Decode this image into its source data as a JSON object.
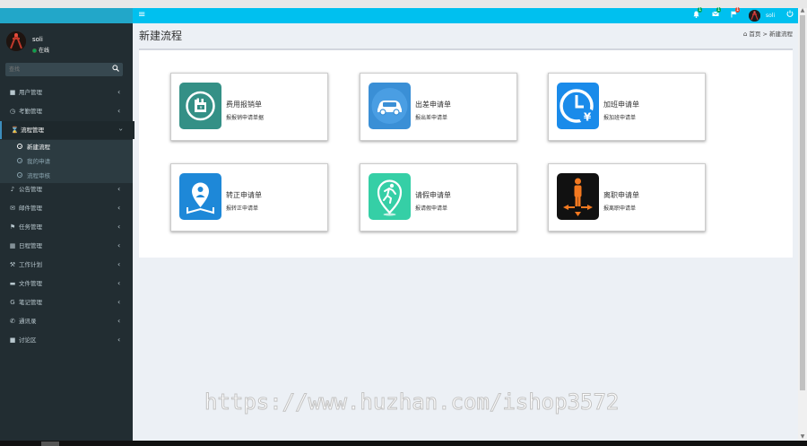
{
  "header": {
    "menu_icon": "hamburger-icon",
    "notifications": [
      {
        "icon": "bell-icon",
        "count": "1",
        "color": "#00a65a"
      },
      {
        "icon": "envelope-icon",
        "count": "1",
        "color": "#00a65a"
      },
      {
        "icon": "flag-icon",
        "count": "1",
        "color": "#dd4b39"
      }
    ],
    "username": "soli",
    "power_icon": "power-icon"
  },
  "sidebar": {
    "user": {
      "name": "soli",
      "status": "在线"
    },
    "search": {
      "placeholder": "查找"
    },
    "items": [
      {
        "label": "用户管理",
        "icon": "users-icon"
      },
      {
        "label": "考勤管理",
        "icon": "clock-icon"
      },
      {
        "label": "流程管理",
        "icon": "hourglass-icon",
        "open": true
      },
      {
        "label": "公告管理",
        "icon": "bell-icon"
      },
      {
        "label": "邮件管理",
        "icon": "envelope-icon"
      },
      {
        "label": "任务管理",
        "icon": "flag-icon"
      },
      {
        "label": "日程管理",
        "icon": "calendar-icon"
      },
      {
        "label": "工作计划",
        "icon": "wrench-icon"
      },
      {
        "label": "文件管理",
        "icon": "folder-icon"
      },
      {
        "label": "笔记管理",
        "icon": "note-icon"
      },
      {
        "label": "通讯录",
        "icon": "phone-icon"
      },
      {
        "label": "讨论区",
        "icon": "comment-icon"
      }
    ],
    "submenu": [
      {
        "label": "新建流程",
        "active": true
      },
      {
        "label": "我的申请",
        "active": false
      },
      {
        "label": "流程审核",
        "active": false
      }
    ]
  },
  "page": {
    "title": "新建流程",
    "breadcrumb": {
      "home": "首页",
      "separator": ">",
      "current": "新建流程"
    }
  },
  "cards": [
    {
      "title": "费用报销单",
      "subtitle": "报报销申请单据",
      "icon": "hand-pay-icon",
      "color": "#2e8b82"
    },
    {
      "title": "出差申请单",
      "subtitle": "报出差申请单",
      "icon": "car-icon",
      "color": "#3a8fd6"
    },
    {
      "title": "加班申请单",
      "subtitle": "报加班申请单",
      "icon": "clock-yen-icon",
      "color": "#2f86e0"
    },
    {
      "title": "转正申请单",
      "subtitle": "报转正申请单",
      "icon": "map-person-icon",
      "color": "#1e88d8"
    },
    {
      "title": "请假申请单",
      "subtitle": "报请假申请单",
      "icon": "runner-icon",
      "color": "#35cfa6"
    },
    {
      "title": "离职申请单",
      "subtitle": "报离职申请单",
      "icon": "person-exit-icon",
      "color": "#111111"
    }
  ],
  "watermark": "https://www.huzhan.com/ishop3572"
}
